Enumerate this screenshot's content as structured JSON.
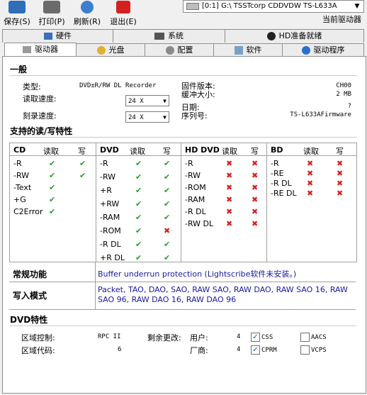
{
  "toolbar": {
    "buttons": [
      {
        "label": "保存(S)",
        "icon": "save-icon"
      },
      {
        "label": "打印(P)",
        "icon": "print-icon"
      },
      {
        "label": "刷新(R)",
        "icon": "refresh-icon"
      },
      {
        "label": "退出(E)",
        "icon": "exit-icon"
      }
    ],
    "drive_value": "[0:1]  G:\\ TSSTcorp CDDVDW TS-L633A",
    "current_drive_label": "当前驱动器"
  },
  "tabs_row1": [
    {
      "label": "硬件",
      "icon": "hardware-icon"
    },
    {
      "label": "系统",
      "icon": "system-icon"
    },
    {
      "label": "HD准备就绪",
      "icon": "hd-ready-icon"
    }
  ],
  "tabs_row2": [
    {
      "label": "驱动器",
      "icon": "drive-icon",
      "active": true
    },
    {
      "label": "光盘",
      "icon": "disc-icon"
    },
    {
      "label": "配置",
      "icon": "config-icon"
    },
    {
      "label": "软件",
      "icon": "software-icon"
    },
    {
      "label": "驱动程序",
      "icon": "driver-icon"
    }
  ],
  "general": {
    "title": "一般",
    "type_label": "类型:",
    "type_value": "DVD±R/RW DL Recorder",
    "read_speed_label": "读取速度:",
    "read_speed_value": "24 X",
    "write_speed_label": "刻录速度:",
    "write_speed_value": "24 X",
    "firmware_label": "固件版本:",
    "firmware_value": "CH00",
    "buffer_label": "缓冲大小:",
    "buffer_value": "2 MB",
    "date_label": "日期:",
    "date_value": "?",
    "serial_label": "序列号:",
    "serial_value": "TS-L633AFirmware"
  },
  "rw": {
    "title": "支持的读/写特性",
    "read_label": "读取",
    "write_label": "写",
    "cd": {
      "name": "CD",
      "rows": [
        {
          "label": "-R",
          "read": "yes",
          "write": "yes"
        },
        {
          "label": "-RW",
          "read": "yes",
          "write": "yes"
        },
        {
          "label": "-Text",
          "read": "yes",
          "write": ""
        },
        {
          "label": "+G",
          "read": "yes",
          "write": ""
        },
        {
          "label": "C2Error",
          "read": "yes",
          "write": ""
        }
      ]
    },
    "dvd": {
      "name": "DVD",
      "rows": [
        {
          "label": "-R",
          "read": "yes",
          "write": "yes"
        },
        {
          "label": "-RW",
          "read": "yes",
          "write": "yes"
        },
        {
          "label": "+R",
          "read": "yes",
          "write": "yes"
        },
        {
          "label": "+RW",
          "read": "yes",
          "write": "yes"
        },
        {
          "label": "-RAM",
          "read": "yes",
          "write": "yes"
        },
        {
          "label": "-ROM",
          "read": "yes",
          "write": "no"
        },
        {
          "label": "-R DL",
          "read": "yes",
          "write": "yes"
        },
        {
          "label": "+R DL",
          "read": "yes",
          "write": "yes"
        }
      ]
    },
    "hddvd": {
      "name": "HD DVD",
      "rows": [
        {
          "label": "-R",
          "read": "no",
          "write": "no"
        },
        {
          "label": "-RW",
          "read": "no",
          "write": "no"
        },
        {
          "label": "-ROM",
          "read": "no",
          "write": "no"
        },
        {
          "label": "-RAM",
          "read": "no",
          "write": "no"
        },
        {
          "label": "-R DL",
          "read": "no",
          "write": "no"
        },
        {
          "label": "-RW DL",
          "read": "no",
          "write": "no"
        }
      ]
    },
    "bd": {
      "name": "BD",
      "rows": [
        {
          "label": "-R",
          "read": "no",
          "write": "no"
        },
        {
          "label": "-RE",
          "read": "no",
          "write": "no"
        },
        {
          "label": "-R DL",
          "read": "no",
          "write": "no"
        },
        {
          "label": "-RE DL",
          "read": "no",
          "write": "no"
        }
      ]
    }
  },
  "features": {
    "general_label": "常规功能",
    "general_value": "Buffer underrun protection (Lightscribe软件未安装。)",
    "write_modes_label": "写入模式",
    "write_modes_value": "Packet, TAO, DAO, SAO, RAW SAO, RAW DAO, RAW SAO 16, RAW SAO 96, RAW DAO 16, RAW DAO 96"
  },
  "dvd_features": {
    "title": "DVD特性",
    "region_control_label": "区域控制:",
    "region_control_value": "RPC II",
    "remaining_label": "剩余更改:",
    "user_label": "用户:",
    "user_value": "4",
    "vendor_label": "厂商:",
    "vendor_value": "4",
    "region_code_label": "区域代码:",
    "region_code_value": "6",
    "css": {
      "label": "CSS",
      "checked": true
    },
    "aacs": {
      "label": "AACS",
      "checked": false
    },
    "cprm": {
      "label": "CPRM",
      "checked": true
    },
    "vcps": {
      "label": "VCPS",
      "checked": false
    }
  },
  "colors": {
    "yes": "#2a9a2a",
    "no": "#d81e1e",
    "link_blue": "#1a1aa0"
  }
}
